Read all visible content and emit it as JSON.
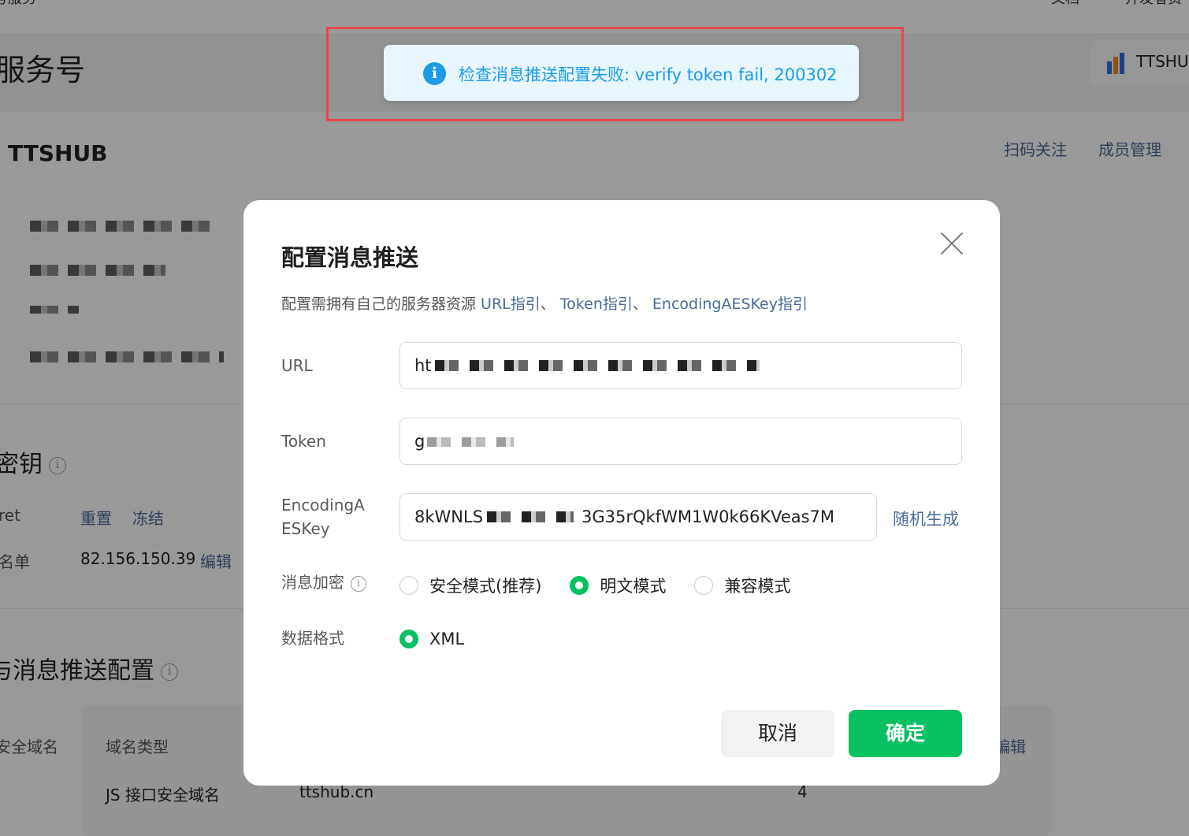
{
  "background": {
    "breadcrumb": "号服务",
    "nav_right": [
      "文档",
      "开发者资"
    ],
    "page_title": "服务号",
    "brand_chip": "TTSHU",
    "account_name": "TTSHUB",
    "card_links": [
      "扫码关注",
      "成员管理"
    ],
    "secret_section_title": "密钥",
    "secret_key_label": "ret",
    "secret_actions": [
      "重置",
      "冻结"
    ],
    "whitelist_label": "名单",
    "whitelist_value": "82.156.150.39",
    "whitelist_edit": "编辑",
    "push_section_title": "与消息推送配置",
    "table_headers": [
      "安全域名",
      "域名类型"
    ],
    "table_edit": "编辑",
    "table_row": {
      "type": "JS 接口安全域名",
      "domain": "ttshub.cn",
      "count": "4"
    }
  },
  "toast": {
    "icon": "info-icon",
    "message": "检查消息推送配置失败: verify token fail, 200302",
    "color": "#1a9ce8"
  },
  "dialog": {
    "title": "配置消息推送",
    "desc_prefix": "配置需拥有自己的服务器资源 ",
    "links": [
      "URL指引",
      "Token指引",
      "EncodingAESKey指引"
    ],
    "link_sep": "、 ",
    "fields": {
      "url": {
        "label": "URL",
        "value": "ht"
      },
      "token": {
        "label": "Token",
        "value": "g"
      },
      "aes": {
        "label_line1": "EncodingA",
        "label_line2": "ESKey",
        "value": "8kWNLS",
        "value_tail": "3G35rQkfWM1W0k66KVeas7M",
        "generate": "随机生成"
      }
    },
    "encryption": {
      "label": "消息加密",
      "options": [
        {
          "label": "安全模式(推荐)",
          "selected": false
        },
        {
          "label": "明文模式",
          "selected": true
        },
        {
          "label": "兼容模式",
          "selected": false
        }
      ]
    },
    "format": {
      "label": "数据格式",
      "options": [
        {
          "label": "XML",
          "selected": true
        }
      ]
    },
    "buttons": {
      "cancel": "取消",
      "confirm": "确定"
    },
    "accent_color": "#07c160"
  }
}
